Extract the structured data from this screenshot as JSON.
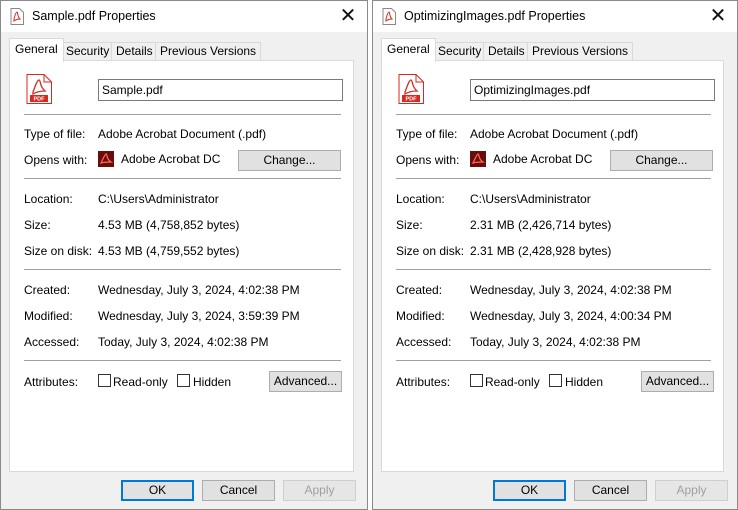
{
  "tabs": [
    "General",
    "Security",
    "Details",
    "Previous Versions"
  ],
  "labels": {
    "type_of_file": "Type of file:",
    "opens_with": "Opens with:",
    "location": "Location:",
    "size": "Size:",
    "size_on_disk": "Size on disk:",
    "created": "Created:",
    "modified": "Modified:",
    "accessed": "Accessed:",
    "attributes": "Attributes:",
    "read_only": "Read-only",
    "hidden": "Hidden"
  },
  "buttons": {
    "change": "Change...",
    "advanced": "Advanced...",
    "ok": "OK",
    "cancel": "Cancel",
    "apply": "Apply"
  },
  "close_glyph": "✕",
  "icons": {
    "file": "pdf-file-icon",
    "app": "adobe-acrobat-icon",
    "title": "pdf-title-icon"
  },
  "colors": {
    "pdf_red": "#d42a1f",
    "app_dark_red": "#6b0c0c",
    "ok_focus_border": "#0078d7"
  },
  "dialogs": [
    {
      "title": "Sample.pdf Properties",
      "file_name": "Sample.pdf",
      "type_of_file": "Adobe Acrobat Document (.pdf)",
      "opens_with": "Adobe Acrobat DC",
      "location": "C:\\Users\\Administrator",
      "size": "4.53 MB (4,758,852 bytes)",
      "size_on_disk": "4.53 MB (4,759,552 bytes)",
      "created": "Wednesday, July 3, 2024, 4:02:38 PM",
      "modified": "Wednesday, July 3, 2024, 3:59:39 PM",
      "accessed": "Today, July 3, 2024, 4:02:38 PM",
      "read_only": false,
      "hidden": false
    },
    {
      "title": "OptimizingImages.pdf Properties",
      "file_name": "OptimizingImages.pdf",
      "type_of_file": "Adobe Acrobat Document (.pdf)",
      "opens_with": "Adobe Acrobat DC",
      "location": "C:\\Users\\Administrator",
      "size": "2.31 MB (2,426,714 bytes)",
      "size_on_disk": "2.31 MB (2,428,928 bytes)",
      "created": "Wednesday, July 3, 2024, 4:02:38 PM",
      "modified": "Wednesday, July 3, 2024, 4:00:34 PM",
      "accessed": "Today, July 3, 2024, 4:02:38 PM",
      "read_only": false,
      "hidden": false
    }
  ]
}
